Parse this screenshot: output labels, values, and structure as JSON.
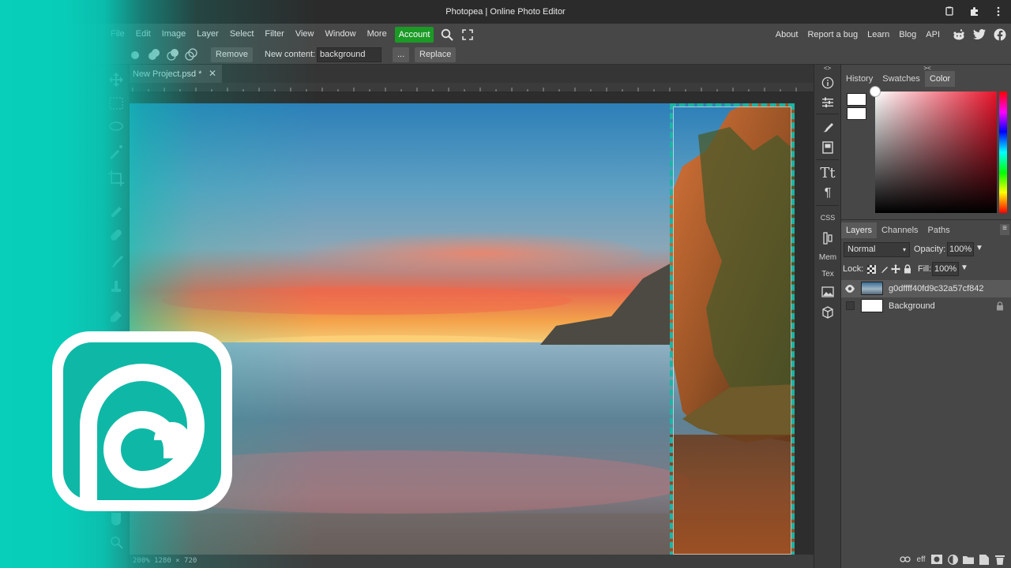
{
  "window": {
    "title": "Photopea | Online Photo Editor"
  },
  "menu": {
    "items": [
      "File",
      "Edit",
      "Image",
      "Layer",
      "Select",
      "Filter",
      "View",
      "Window",
      "More"
    ],
    "account_label": "Account",
    "right_links": [
      "About",
      "Report a bug",
      "Learn",
      "Blog",
      "API"
    ]
  },
  "options": {
    "remove_label": "Remove",
    "new_content_label": "New content:",
    "new_content_value": "background",
    "more_label": "...",
    "replace_label": "Replace"
  },
  "document": {
    "tab_label": "New Project.psd *",
    "status": "200%   1280 × 720"
  },
  "midstrip": {
    "css_label": "CSS",
    "mem_label": "Mem",
    "tex_label": "Tex"
  },
  "color_panel": {
    "tabs": [
      "History",
      "Swatches",
      "Color"
    ],
    "active_tab": "Color",
    "foreground": "#ffffff",
    "background": "#ffffff"
  },
  "layers_panel": {
    "tabs": [
      "Layers",
      "Channels",
      "Paths"
    ],
    "active_tab": "Layers",
    "blend_mode": "Normal",
    "opacity_label": "Opacity:",
    "opacity": "100%",
    "lock_label": "Lock:",
    "fill_label": "Fill:",
    "fill": "100%",
    "layers": [
      {
        "name": "g0dffff40fd9c32a57cf842",
        "visible": true,
        "selected": true
      },
      {
        "name": "Background",
        "visible": false,
        "selected": false,
        "locked": true
      }
    ],
    "footer_icons": [
      "link-icon",
      "effects-icon",
      "mask-icon",
      "adjustment-icon",
      "folder-icon",
      "new-layer-icon",
      "trash-icon"
    ],
    "effects_label": "eff"
  },
  "colors": {
    "accent_teal": "#0fc7b3",
    "account_green": "#1b9a26",
    "ui_dark": "#474747"
  }
}
